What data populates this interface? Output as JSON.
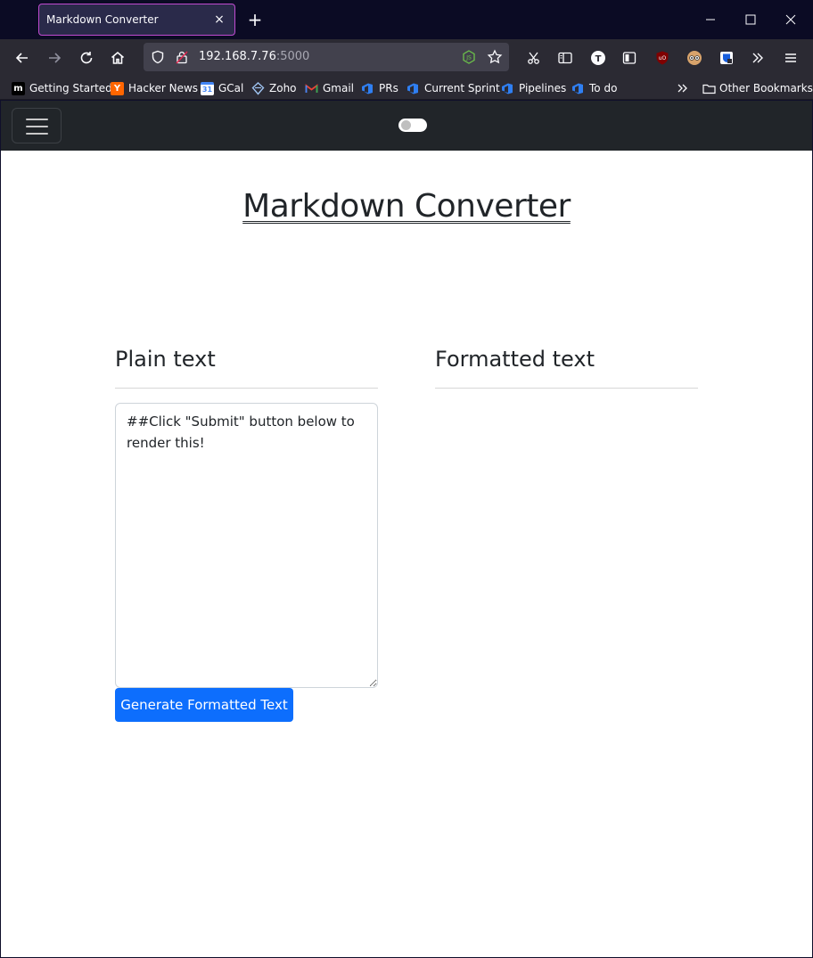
{
  "browser": {
    "tab": {
      "title": "Markdown Converter",
      "close_glyph": "×"
    },
    "new_tab_glyph": "+",
    "url": {
      "host": "192.168.7.76",
      "port": ":5000"
    },
    "bookmarks": [
      {
        "label": "Getting Started",
        "icon": "m",
        "color": "#000000"
      },
      {
        "label": "Hacker News",
        "icon": "Y",
        "color": "#ff6600"
      },
      {
        "label": "GCal",
        "icon": "31",
        "color": "#4285f4"
      },
      {
        "label": "Zoho",
        "icon": "Z",
        "color": "#5a8fd6"
      },
      {
        "label": "Gmail",
        "icon": "M",
        "color": "#ea4335"
      },
      {
        "label": "PRs",
        "icon": "az",
        "color": "#2f7ff2"
      },
      {
        "label": "Current Sprint",
        "icon": "az",
        "color": "#2f7ff2"
      },
      {
        "label": "Pipelines",
        "icon": "az",
        "color": "#2f7ff2"
      },
      {
        "label": "To do",
        "icon": "az",
        "color": "#2f7ff2"
      }
    ],
    "other_bookmarks": "Other Bookmarks",
    "extension_avatar_letter": "T"
  },
  "page": {
    "title": "Markdown Converter",
    "plain_heading": "Plain text",
    "formatted_heading": "Formatted text",
    "textarea_value": "##Click \"Submit\" button below to render this!",
    "generate_button": "Generate Formatted Text",
    "formatted_output": ""
  },
  "colors": {
    "primary": "#0d6efd",
    "navbar": "#212529",
    "tab_accent": "#c04ad0"
  }
}
